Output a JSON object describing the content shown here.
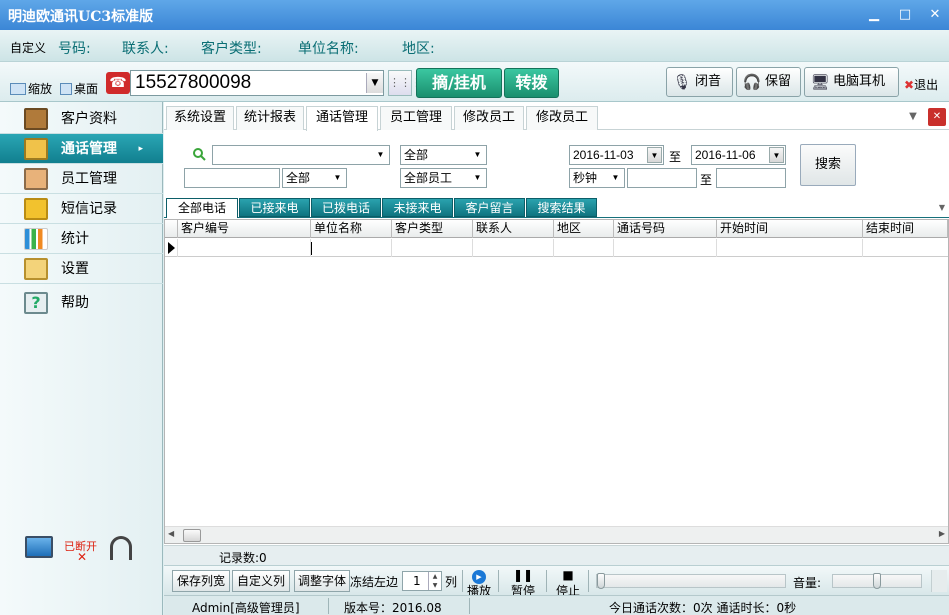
{
  "app": {
    "title": "明迪欧通讯UC3标准版"
  },
  "window_controls": {
    "minimize": "▁",
    "maximize": "□",
    "close": "✕"
  },
  "info": {
    "custom": "自定义",
    "phone_label": "号码:",
    "contact_label": "联系人:",
    "customer_type_label": "客户类型:",
    "company_label": "单位名称:",
    "region_label": "地区:"
  },
  "toolbar": {
    "shrink": "缩放",
    "desktop": "桌面",
    "phone_number": "15527800098",
    "pickup_hangup": "摘/挂机",
    "transfer": "转拨",
    "mute": "闭音",
    "hold": "保留",
    "pc_headset": "电脑耳机",
    "exit": "退出"
  },
  "sidebar": {
    "items": [
      {
        "label": "客户资料",
        "icon": "customer-icon"
      },
      {
        "label": "通话管理",
        "icon": "call-management-icon",
        "active": true
      },
      {
        "label": "员工管理",
        "icon": "staff-icon"
      },
      {
        "label": "短信记录",
        "icon": "sms-envelope-icon"
      },
      {
        "label": "统计",
        "icon": "bar-chart-icon"
      },
      {
        "label": "设置",
        "icon": "settings-icon"
      },
      {
        "label": "帮助",
        "icon": "help-icon"
      }
    ],
    "connection_status": "已断开"
  },
  "tabs": [
    "系统设置",
    "统计报表",
    "通话管理",
    "员工管理",
    "修改员工",
    "修改员工"
  ],
  "filters": {
    "search_value": "",
    "all_1": "全部",
    "all_2": "全部",
    "all_staff": "全部员工",
    "unit": "秒钟",
    "date_from": "2016-11-03",
    "to_1": "至",
    "date_to": "2016-11-06",
    "to_2": "至",
    "search_button": "搜索"
  },
  "subtabs": [
    "全部电话",
    "已接来电",
    "已拨电话",
    "未接来电",
    "客户留言",
    "搜索结果"
  ],
  "grid": {
    "columns": [
      "客户编号",
      "单位名称",
      "客户类型",
      "联系人",
      "地区",
      "通话号码",
      "开始时间",
      "结束时间"
    ]
  },
  "record_count": "记录数:0",
  "bottom": {
    "save_width": "保存列宽",
    "customize_columns": "自定义列",
    "adjust_font": "调整字体",
    "freeze_left": "冻结左边",
    "freeze_count": "1",
    "column_unit": "列",
    "play": "播放",
    "pause": "暂停",
    "stop": "停止",
    "volume": "音量:"
  },
  "playback_progress": 0.0,
  "volume_level": 0.5,
  "status": {
    "user": "Admin[高级管理员]",
    "version": "版本号：2016.08",
    "today": "今日通话次数：0次 通话时长：0秒"
  }
}
